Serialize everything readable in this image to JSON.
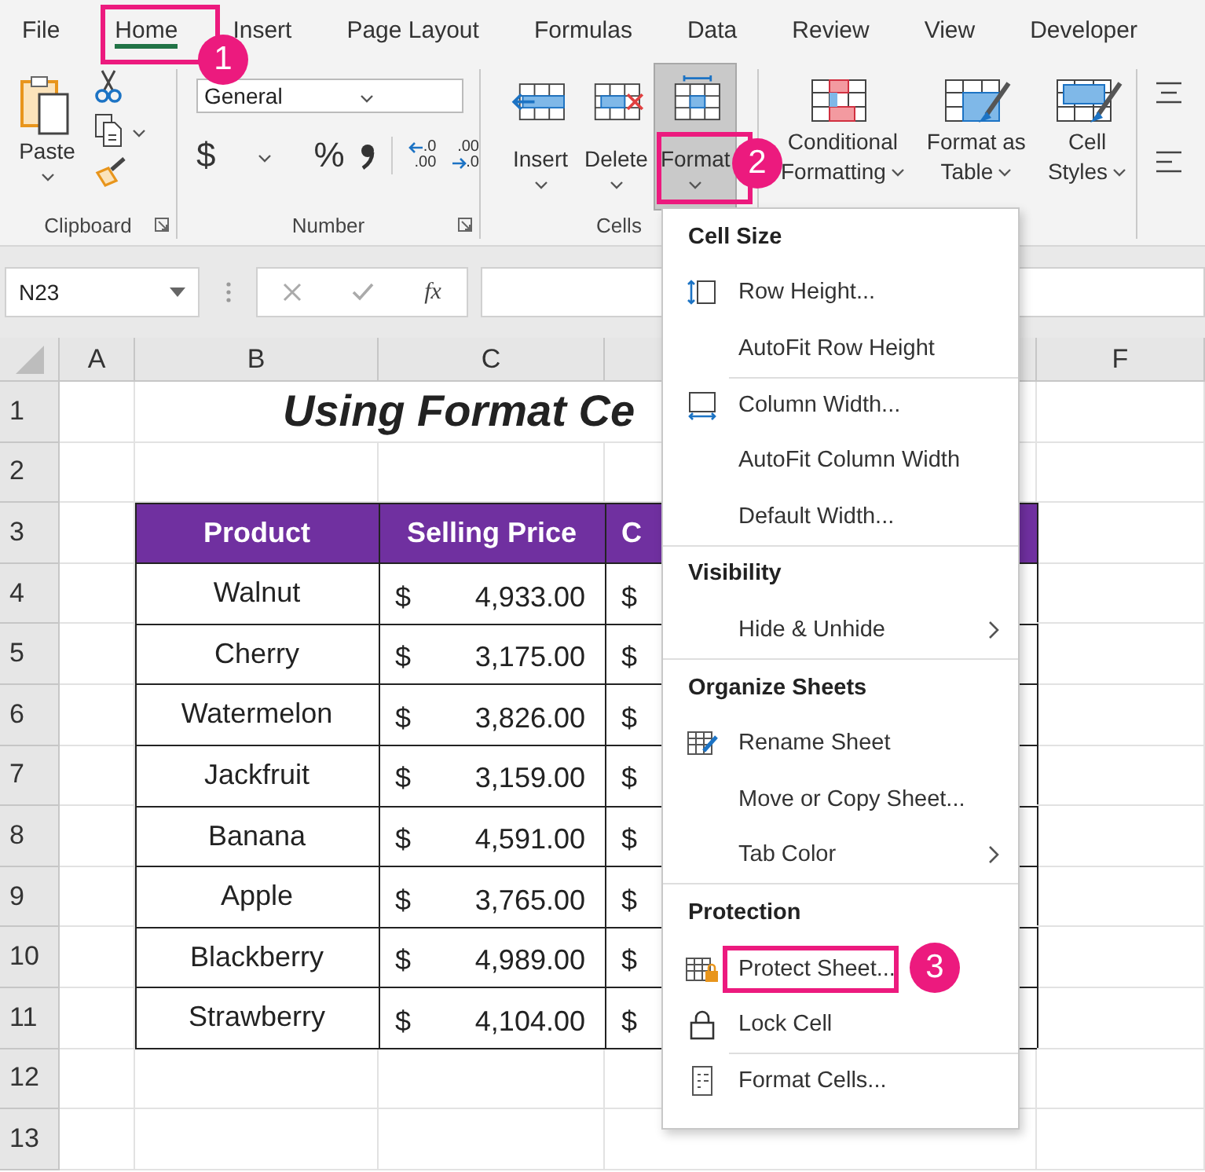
{
  "tabs": [
    {
      "label": "File",
      "selected": false
    },
    {
      "label": "Home",
      "selected": true
    },
    {
      "label": "Insert",
      "selected": false
    },
    {
      "label": "Page Layout",
      "selected": false
    },
    {
      "label": "Formulas",
      "selected": false
    },
    {
      "label": "Data",
      "selected": false
    },
    {
      "label": "Review",
      "selected": false
    },
    {
      "label": "View",
      "selected": false
    },
    {
      "label": "Developer",
      "selected": false
    }
  ],
  "ribbon": {
    "clipboard": {
      "label": "Clipboard",
      "paste": "Paste"
    },
    "number": {
      "label": "Number",
      "format": "General",
      "currency": "$",
      "percent": "%",
      "decimals": [
        {
          "top": ".0",
          "bottom": ".00"
        },
        {
          "top": ".00",
          "bottom": ".0"
        }
      ]
    },
    "cells": {
      "label": "Cells",
      "buttons": [
        {
          "label": "Insert",
          "selected": false
        },
        {
          "label": "Delete",
          "selected": false
        },
        {
          "label": "Format",
          "selected": true
        }
      ]
    },
    "styles": {
      "buttons": [
        {
          "lines": [
            "Conditional",
            "Formatting"
          ]
        },
        {
          "lines": [
            "Format as",
            "Table"
          ]
        },
        {
          "lines": [
            "Cell",
            "Styles"
          ]
        }
      ]
    }
  },
  "formula_bar": {
    "name_box": "N23",
    "function_label": "fx"
  },
  "sheet": {
    "columns": [
      "A",
      "B",
      "C",
      "F"
    ],
    "rows": [
      "1",
      "2",
      "3",
      "4",
      "5",
      "6",
      "7",
      "8",
      "9",
      "10",
      "11",
      "12",
      "13"
    ],
    "title": "Using Format Ce",
    "table": {
      "headers": [
        "Product",
        "Selling Price",
        "C"
      ],
      "rows": [
        {
          "product": "Walnut",
          "currency": "$",
          "price": "4,933.00",
          "column_d": "$"
        },
        {
          "product": "Cherry",
          "currency": "$",
          "price": "3,175.00",
          "column_d": "$"
        },
        {
          "product": "Watermelon",
          "currency": "$",
          "price": "3,826.00",
          "column_d": "$"
        },
        {
          "product": "Jackfruit",
          "currency": "$",
          "price": "3,159.00",
          "column_d": "$"
        },
        {
          "product": "Banana",
          "currency": "$",
          "price": "4,591.00",
          "column_d": "$"
        },
        {
          "product": "Apple",
          "currency": "$",
          "price": "3,765.00",
          "column_d": "$"
        },
        {
          "product": "Blackberry",
          "currency": "$",
          "price": "4,989.00",
          "column_d": "$"
        },
        {
          "product": "Strawberry",
          "currency": "$",
          "price": "4,104.00",
          "column_d": "$"
        }
      ]
    }
  },
  "format_menu": {
    "sections": [
      {
        "title": "Cell Size",
        "items": [
          {
            "label": "Row Height...",
            "divider_above": false,
            "submenu": false
          },
          {
            "label": "AutoFit Row Height",
            "divider_above": false,
            "submenu": false
          },
          {
            "label": "Column Width...",
            "divider_above": true,
            "submenu": false
          },
          {
            "label": "AutoFit Column Width",
            "divider_above": false,
            "submenu": false
          },
          {
            "label": "Default Width...",
            "divider_above": false,
            "submenu": false
          }
        ]
      },
      {
        "title": "Visibility",
        "items": [
          {
            "label": "Hide & Unhide",
            "divider_above": false,
            "submenu": true
          }
        ]
      },
      {
        "title": "Organize Sheets",
        "items": [
          {
            "label": "Rename Sheet",
            "divider_above": false,
            "submenu": false
          },
          {
            "label": "Move or Copy Sheet...",
            "divider_above": false,
            "submenu": false
          },
          {
            "label": "Tab Color",
            "divider_above": false,
            "submenu": true
          }
        ]
      },
      {
        "title": "Protection",
        "items": [
          {
            "label": "Protect Sheet...",
            "divider_above": false,
            "submenu": false
          },
          {
            "label": "Lock Cell",
            "divider_above": false,
            "submenu": false
          },
          {
            "label": "Format Cells...",
            "divider_above": true,
            "submenu": false
          }
        ]
      }
    ]
  },
  "callouts": [
    {
      "number": "1"
    },
    {
      "number": "2"
    },
    {
      "number": "3"
    }
  ]
}
